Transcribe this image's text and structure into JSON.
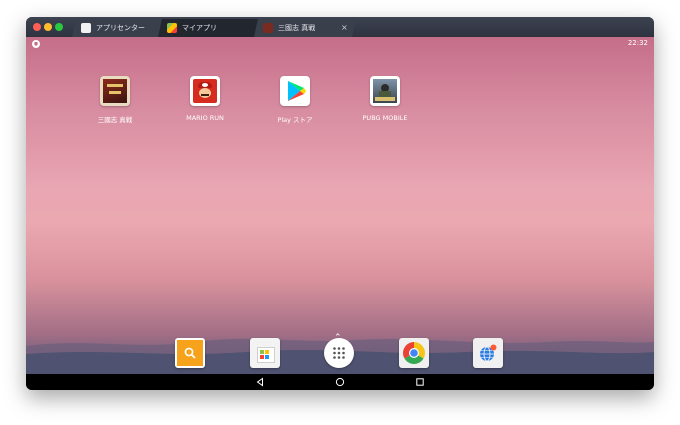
{
  "tabs": [
    {
      "label": "アプリセンター",
      "icon": "app-center-icon",
      "active": false
    },
    {
      "label": "マイアプリ",
      "icon": "bluestacks-icon",
      "active": true
    },
    {
      "label": "三國志 真戦",
      "icon": "sangokushi-icon",
      "active": false,
      "close": "×"
    }
  ],
  "status": {
    "time": "22:32"
  },
  "apps": [
    {
      "label": "三國志 真戦",
      "icon": "sangokushi-icon"
    },
    {
      "label": "MARIO RUN",
      "icon": "mario-run-icon"
    },
    {
      "label": "Play ストア",
      "icon": "play-store-icon"
    },
    {
      "label": "PUBG MOBILE",
      "icon": "pubg-icon"
    }
  ],
  "dock": [
    "search-icon",
    "app-center-icon",
    "app-drawer-icon",
    "chrome-icon",
    "browser-icon"
  ],
  "colors": {
    "titlebar": "#2f3340",
    "tab_active": "#22262f",
    "close": "#ff5f57",
    "minimize": "#febc2e",
    "maximize": "#28c840"
  }
}
